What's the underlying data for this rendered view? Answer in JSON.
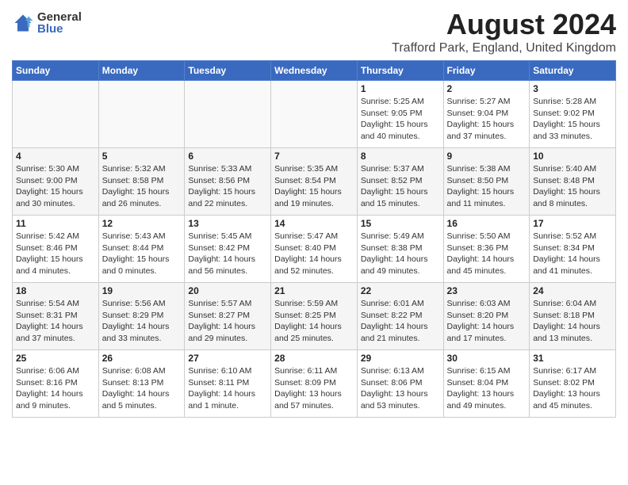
{
  "header": {
    "logo_general": "General",
    "logo_blue": "Blue",
    "title": "August 2024",
    "subtitle": "Trafford Park, England, United Kingdom"
  },
  "weekdays": [
    "Sunday",
    "Monday",
    "Tuesday",
    "Wednesday",
    "Thursday",
    "Friday",
    "Saturday"
  ],
  "weeks": [
    [
      {
        "day": "",
        "info": ""
      },
      {
        "day": "",
        "info": ""
      },
      {
        "day": "",
        "info": ""
      },
      {
        "day": "",
        "info": ""
      },
      {
        "day": "1",
        "info": "Sunrise: 5:25 AM\nSunset: 9:05 PM\nDaylight: 15 hours\nand 40 minutes."
      },
      {
        "day": "2",
        "info": "Sunrise: 5:27 AM\nSunset: 9:04 PM\nDaylight: 15 hours\nand 37 minutes."
      },
      {
        "day": "3",
        "info": "Sunrise: 5:28 AM\nSunset: 9:02 PM\nDaylight: 15 hours\nand 33 minutes."
      }
    ],
    [
      {
        "day": "4",
        "info": "Sunrise: 5:30 AM\nSunset: 9:00 PM\nDaylight: 15 hours\nand 30 minutes."
      },
      {
        "day": "5",
        "info": "Sunrise: 5:32 AM\nSunset: 8:58 PM\nDaylight: 15 hours\nand 26 minutes."
      },
      {
        "day": "6",
        "info": "Sunrise: 5:33 AM\nSunset: 8:56 PM\nDaylight: 15 hours\nand 22 minutes."
      },
      {
        "day": "7",
        "info": "Sunrise: 5:35 AM\nSunset: 8:54 PM\nDaylight: 15 hours\nand 19 minutes."
      },
      {
        "day": "8",
        "info": "Sunrise: 5:37 AM\nSunset: 8:52 PM\nDaylight: 15 hours\nand 15 minutes."
      },
      {
        "day": "9",
        "info": "Sunrise: 5:38 AM\nSunset: 8:50 PM\nDaylight: 15 hours\nand 11 minutes."
      },
      {
        "day": "10",
        "info": "Sunrise: 5:40 AM\nSunset: 8:48 PM\nDaylight: 15 hours\nand 8 minutes."
      }
    ],
    [
      {
        "day": "11",
        "info": "Sunrise: 5:42 AM\nSunset: 8:46 PM\nDaylight: 15 hours\nand 4 minutes."
      },
      {
        "day": "12",
        "info": "Sunrise: 5:43 AM\nSunset: 8:44 PM\nDaylight: 15 hours\nand 0 minutes."
      },
      {
        "day": "13",
        "info": "Sunrise: 5:45 AM\nSunset: 8:42 PM\nDaylight: 14 hours\nand 56 minutes."
      },
      {
        "day": "14",
        "info": "Sunrise: 5:47 AM\nSunset: 8:40 PM\nDaylight: 14 hours\nand 52 minutes."
      },
      {
        "day": "15",
        "info": "Sunrise: 5:49 AM\nSunset: 8:38 PM\nDaylight: 14 hours\nand 49 minutes."
      },
      {
        "day": "16",
        "info": "Sunrise: 5:50 AM\nSunset: 8:36 PM\nDaylight: 14 hours\nand 45 minutes."
      },
      {
        "day": "17",
        "info": "Sunrise: 5:52 AM\nSunset: 8:34 PM\nDaylight: 14 hours\nand 41 minutes."
      }
    ],
    [
      {
        "day": "18",
        "info": "Sunrise: 5:54 AM\nSunset: 8:31 PM\nDaylight: 14 hours\nand 37 minutes."
      },
      {
        "day": "19",
        "info": "Sunrise: 5:56 AM\nSunset: 8:29 PM\nDaylight: 14 hours\nand 33 minutes."
      },
      {
        "day": "20",
        "info": "Sunrise: 5:57 AM\nSunset: 8:27 PM\nDaylight: 14 hours\nand 29 minutes."
      },
      {
        "day": "21",
        "info": "Sunrise: 5:59 AM\nSunset: 8:25 PM\nDaylight: 14 hours\nand 25 minutes."
      },
      {
        "day": "22",
        "info": "Sunrise: 6:01 AM\nSunset: 8:22 PM\nDaylight: 14 hours\nand 21 minutes."
      },
      {
        "day": "23",
        "info": "Sunrise: 6:03 AM\nSunset: 8:20 PM\nDaylight: 14 hours\nand 17 minutes."
      },
      {
        "day": "24",
        "info": "Sunrise: 6:04 AM\nSunset: 8:18 PM\nDaylight: 14 hours\nand 13 minutes."
      }
    ],
    [
      {
        "day": "25",
        "info": "Sunrise: 6:06 AM\nSunset: 8:16 PM\nDaylight: 14 hours\nand 9 minutes."
      },
      {
        "day": "26",
        "info": "Sunrise: 6:08 AM\nSunset: 8:13 PM\nDaylight: 14 hours\nand 5 minutes."
      },
      {
        "day": "27",
        "info": "Sunrise: 6:10 AM\nSunset: 8:11 PM\nDaylight: 14 hours\nand 1 minute."
      },
      {
        "day": "28",
        "info": "Sunrise: 6:11 AM\nSunset: 8:09 PM\nDaylight: 13 hours\nand 57 minutes."
      },
      {
        "day": "29",
        "info": "Sunrise: 6:13 AM\nSunset: 8:06 PM\nDaylight: 13 hours\nand 53 minutes."
      },
      {
        "day": "30",
        "info": "Sunrise: 6:15 AM\nSunset: 8:04 PM\nDaylight: 13 hours\nand 49 minutes."
      },
      {
        "day": "31",
        "info": "Sunrise: 6:17 AM\nSunset: 8:02 PM\nDaylight: 13 hours\nand 45 minutes."
      }
    ]
  ]
}
